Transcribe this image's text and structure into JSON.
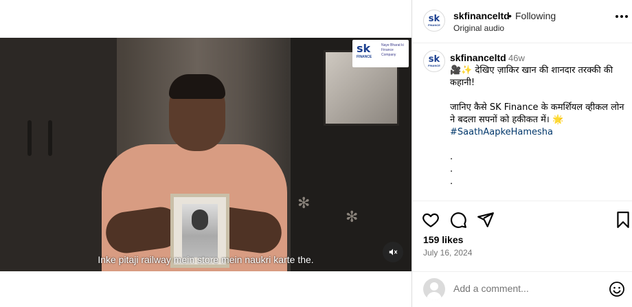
{
  "video": {
    "subtitle": "Inke pitaji railway mein store mein naukri karte the.",
    "logo": {
      "mark": "sk",
      "sub": "FINANCE",
      "tagline": "Naye Bharat ki Finance Company"
    },
    "muted": true
  },
  "header": {
    "username": "skfinanceltd",
    "separator": "•",
    "follow_status": "Following",
    "audio": "Original audio"
  },
  "caption": {
    "username": "skfinanceltd",
    "time": "46w",
    "line1": "🎥✨ देखिए ज़ाकिर खान की शानदार तरक्की की कहानी!",
    "line2": "जानिए कैसे SK Finance के कमर्शियल व्हीकल लोन ने बदला सपनों को हकीकत में। 🌟",
    "hashtag": "#SaathAapkeHamesha",
    "dots": [
      ".",
      ".",
      "."
    ]
  },
  "post": {
    "likes": "159 likes",
    "date": "July 16, 2024"
  },
  "comment": {
    "placeholder": "Add a comment..."
  },
  "icons": {
    "like": "heart-icon",
    "comment": "comment-icon",
    "share": "share-icon",
    "save": "bookmark-icon",
    "more": "more-icon",
    "emoji": "emoji-icon",
    "mute": "speaker-muted-icon"
  }
}
